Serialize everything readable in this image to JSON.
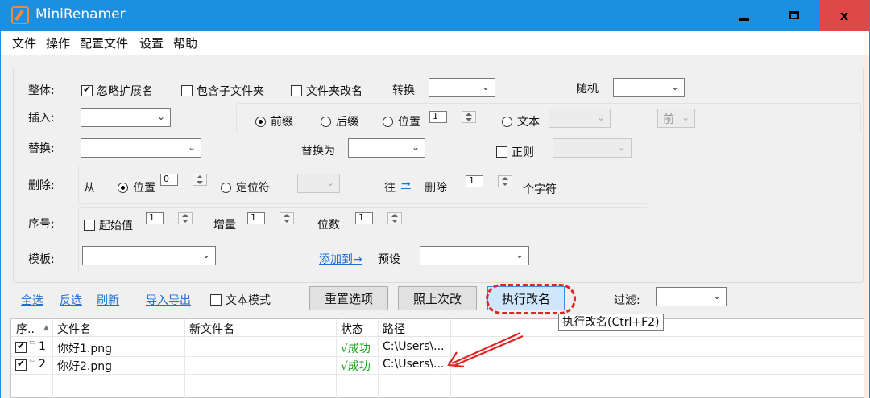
{
  "window": {
    "title": "MiniRenamer",
    "minimize": "–",
    "maximize": "□",
    "close": "x"
  },
  "menu": [
    "文件",
    "操作",
    "配置文件",
    "设置",
    "帮助"
  ],
  "overall": {
    "label": "整体:",
    "ignore_ext": "忽略扩展名",
    "include_sub": "包含子文件夹",
    "folder_rename": "文件夹改名",
    "convert": "转换",
    "random": "随机"
  },
  "insert": {
    "label": "插入:",
    "prefix": "前缀",
    "suffix": "后缀",
    "position": "位置",
    "position_value": "1",
    "text": "文本",
    "front": "前"
  },
  "replace": {
    "label": "替换:",
    "replace_with": "替换为",
    "regex": "正则"
  },
  "delete": {
    "label": "删除:",
    "from": "从",
    "position": "位置",
    "position_value": "0",
    "locator": "定位符",
    "to": "往",
    "arrow": "→",
    "delete": "删除",
    "count": "1",
    "chars": "个字符"
  },
  "sequence": {
    "label": "序号:",
    "start": "起始值",
    "start_value": "1",
    "increment": "增量",
    "increment_value": "1",
    "digits": "位数",
    "digits_value": "1"
  },
  "template": {
    "label": "模板:",
    "add_to": "添加到→",
    "preset": "预设"
  },
  "toolbar": {
    "select_all": "全选",
    "invert": "反选",
    "refresh": "刷新",
    "import_export": "导入导出",
    "text_mode": "文本模式",
    "reset": "重置选项",
    "last_time": "照上次改",
    "execute": "执行改名",
    "filter": "过滤:"
  },
  "tooltip": "执行改名(Ctrl+F2)",
  "table": {
    "headers": {
      "seq": "序..",
      "sort": "▲",
      "filename": "文件名",
      "newname": "新文件名",
      "status": "状态",
      "path": "路径"
    },
    "rows": [
      {
        "seq": "1",
        "filename": "你好1.png",
        "newname": "",
        "status": "√成功",
        "path": "C:\\Users\\..."
      },
      {
        "seq": "2",
        "filename": "你好2.png",
        "newname": "",
        "status": "√成功",
        "path": "C:\\Users\\..."
      }
    ]
  },
  "colors": {
    "titlebar": "#1b8fe0",
    "close": "#e04848",
    "annotation": "#e02424",
    "success": "#16a016",
    "link": "#1c6fd6"
  }
}
